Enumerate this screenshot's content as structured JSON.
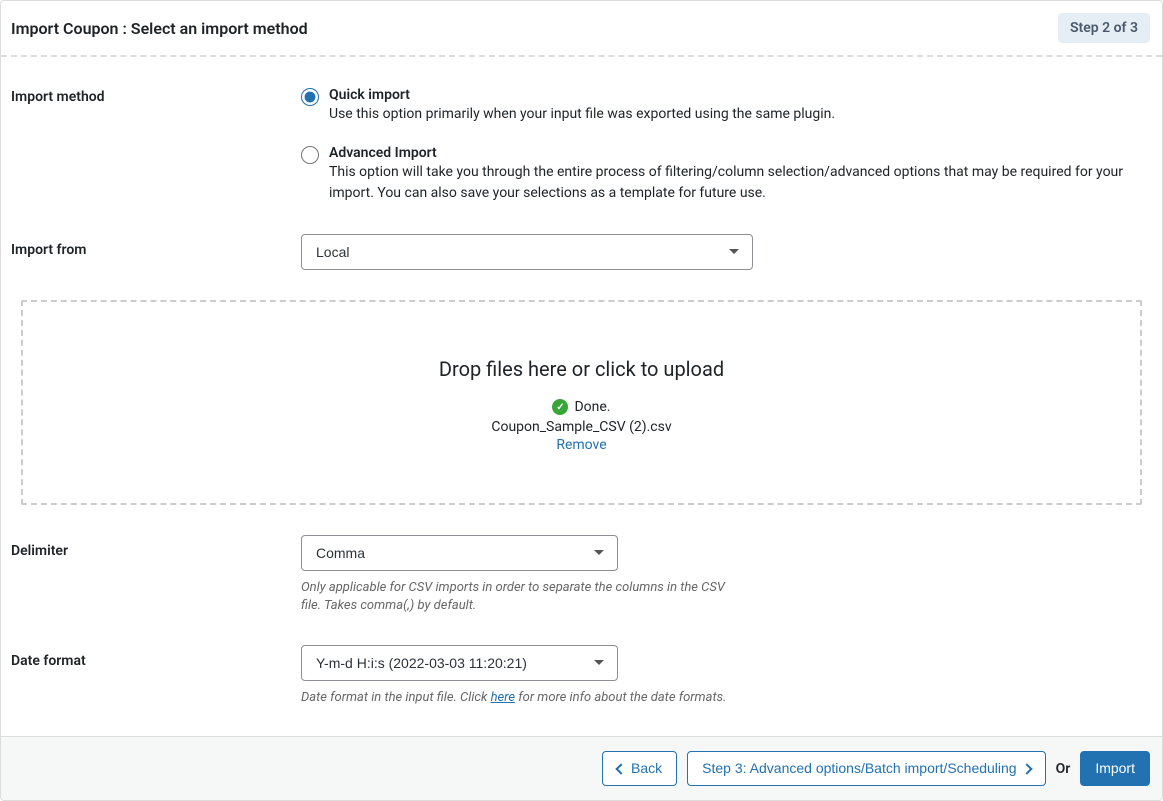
{
  "header": {
    "title": "Import Coupon : Select an import method",
    "step_badge": "Step 2 of 3"
  },
  "import_method": {
    "label": "Import method",
    "options": {
      "quick": {
        "title": "Quick import",
        "desc": "Use this option primarily when your input file was exported using the same plugin."
      },
      "advanced": {
        "title": "Advanced Import",
        "desc": "This option will take you through the entire process of filtering/column selection/advanced options that may be required for your import. You can also save your selections as a template for future use."
      }
    }
  },
  "import_from": {
    "label": "Import from",
    "value": "Local"
  },
  "dropzone": {
    "title": "Drop files here or click to upload",
    "status": "Done.",
    "filename": "Coupon_Sample_CSV (2).csv",
    "remove": "Remove"
  },
  "delimiter": {
    "label": "Delimiter",
    "value": "Comma",
    "help": "Only applicable for CSV imports in order to separate the columns in the CSV file. Takes comma(,) by default."
  },
  "date_format": {
    "label": "Date format",
    "value": "Y-m-d H:i:s (2022-03-03 11:20:21)",
    "help_pre": "Date format in the input file. Click ",
    "help_link": "here",
    "help_post": " for more info about the date formats."
  },
  "footer": {
    "back": "Back",
    "step3": "Step 3: Advanced options/Batch import/Scheduling",
    "or": "Or",
    "import": "Import"
  }
}
